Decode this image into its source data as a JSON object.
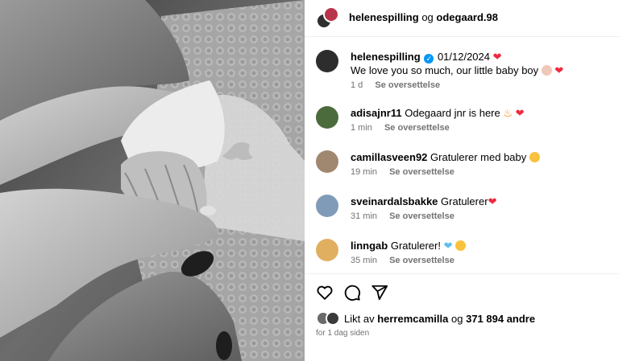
{
  "header": {
    "user1": "helenespilling",
    "conjunction": "og",
    "user2": "odegaard.98"
  },
  "comments": [
    {
      "username": "helenespilling",
      "verified": true,
      "date": "01/12/2024",
      "text": "We love you so much, our little baby boy",
      "time": "1 d",
      "translate": "Se oversettelse"
    },
    {
      "username": "adisajnr11",
      "text": "Odegaard jnr is here",
      "time": "1 min",
      "translate": "Se oversettelse"
    },
    {
      "username": "camillasveen92",
      "text": "Gratulerer med baby",
      "time": "19 min",
      "translate": "Se oversettelse"
    },
    {
      "username": "sveinardalsbakke",
      "text": "Gratulerer",
      "time": "31 min",
      "translate": "Se oversettelse"
    },
    {
      "username": "linngab",
      "text": "Gratulerer!",
      "time": "35 min",
      "translate": "Se oversettelse"
    }
  ],
  "actions": {
    "like_icon": "heart-outline-icon",
    "comment_icon": "speech-bubble-icon",
    "share_icon": "paper-plane-icon"
  },
  "likes": {
    "prefix": "Likt av",
    "user": "herremcamilla",
    "and": "og",
    "count": "371 894 andre"
  },
  "posted": "for 1 dag siden",
  "colors": {
    "heart_red": "#ed2a3f",
    "verified_blue": "#0095f6",
    "meta_gray": "#737373",
    "divider": "#efefef"
  }
}
